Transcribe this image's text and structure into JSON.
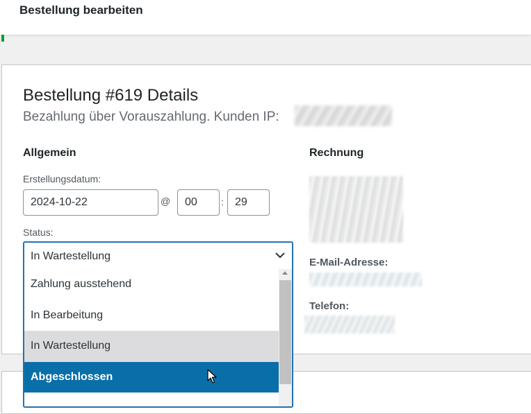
{
  "header": {
    "title": "Bestellung bearbeiten"
  },
  "order": {
    "title": "Bestellung #619 Details",
    "subtitle": "Bezahlung über Vorauszahlung. Kunden IP:"
  },
  "general": {
    "heading": "Allgemein",
    "date_label": "Erstellungsdatum:",
    "date_value": "2024-10-22",
    "at_symbol": "@",
    "hour_value": "00",
    "time_sep": ":",
    "minute_value": "29",
    "status_label": "Status:",
    "status_selected": "In Wartestellung",
    "status_options": [
      "Zahlung ausstehend",
      "In Bearbeitung",
      "In Wartestellung",
      "Abgeschlossen"
    ]
  },
  "billing": {
    "heading": "Rechnung",
    "email_label": "E-Mail-Adresse:",
    "phone_label": "Telefon:"
  },
  "colors": {
    "accent": "#2271b1",
    "highlight": "#0a6fa8",
    "hover": "#dcdcde",
    "green": "#00a32a"
  }
}
